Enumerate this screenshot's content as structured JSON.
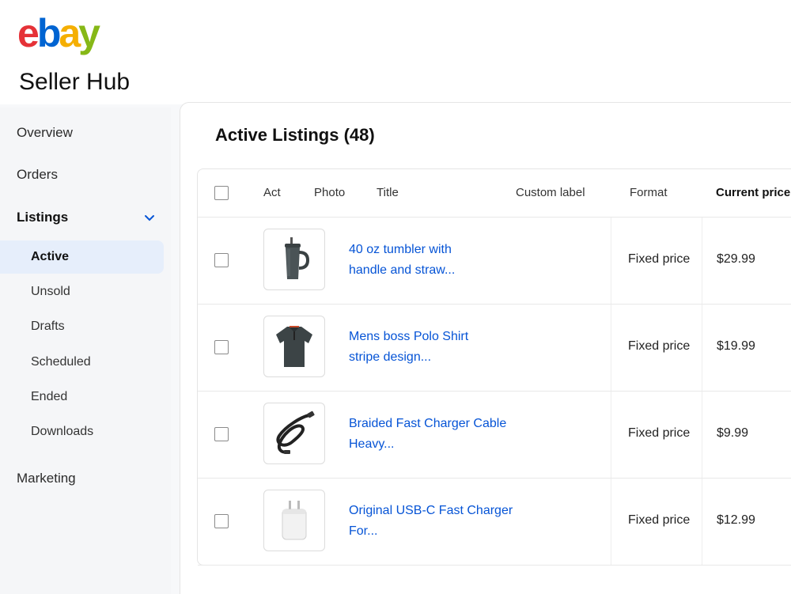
{
  "brand": {
    "logo_letters": [
      "e",
      "b",
      "a",
      "y"
    ],
    "logo_colors": [
      "#e53238",
      "#0064d2",
      "#f5af02",
      "#86b817"
    ],
    "hub_title": "Seller Hub"
  },
  "sidebar": {
    "items": [
      {
        "label": "Overview"
      },
      {
        "label": "Orders"
      },
      {
        "label": "Listings",
        "expanded": true,
        "icon": "chevron-down-icon"
      },
      {
        "label": "Marketing"
      }
    ],
    "listings_sub": [
      {
        "label": "Active",
        "selected": true
      },
      {
        "label": "Unsold"
      },
      {
        "label": "Drafts"
      },
      {
        "label": "Scheduled"
      },
      {
        "label": "Ended"
      },
      {
        "label": "Downloads"
      }
    ]
  },
  "main": {
    "title": "Active Listings (48)",
    "columns": [
      "Act",
      "Photo",
      "Title",
      "Custom label",
      "Format",
      "Current price"
    ],
    "rows": [
      {
        "title_line1": "40 oz tumbler with",
        "title_line2": "handle and straw...",
        "format": "Fixed price",
        "price": "$29.99",
        "photo_icon": "tumbler-photo"
      },
      {
        "title_line1": "Mens boss Polo Shirt",
        "title_line2": "stripe design...",
        "format": "Fixed price",
        "price": "$19.99",
        "photo_icon": "polo-shirt-photo"
      },
      {
        "title_line1": "Braided Fast Charger Cable",
        "title_line2": "Heavy...",
        "format": "Fixed price",
        "price": "$9.99",
        "photo_icon": "charger-cable-photo"
      },
      {
        "title_line1": "Original USB-C Fast Charger",
        "title_line2": "For...",
        "format": "Fixed price",
        "price": "$12.99",
        "photo_icon": "usb-c-charger-photo"
      }
    ]
  },
  "colors": {
    "link": "#0654d6",
    "active_nav_bg": "#e6eefb"
  }
}
